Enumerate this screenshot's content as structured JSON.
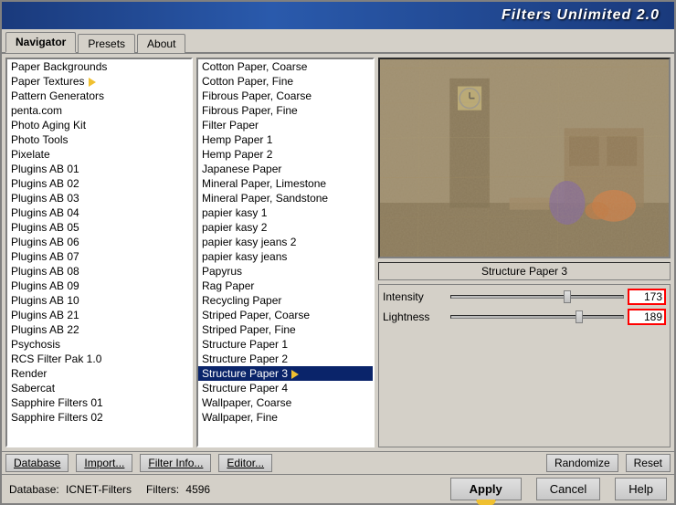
{
  "window": {
    "title": "Filters Unlimited 2.0"
  },
  "tabs": [
    {
      "id": "navigator",
      "label": "Navigator",
      "active": true
    },
    {
      "id": "presets",
      "label": "Presets",
      "active": false
    },
    {
      "id": "about",
      "label": "About",
      "active": false
    }
  ],
  "categories": [
    {
      "id": 1,
      "label": "Paper Backgrounds",
      "selected": false
    },
    {
      "id": 2,
      "label": "Paper Textures",
      "selected": false,
      "hint": true
    },
    {
      "id": 3,
      "label": "Pattern Generators",
      "selected": false
    },
    {
      "id": 4,
      "label": "penta.com",
      "selected": false
    },
    {
      "id": 5,
      "label": "Photo Aging Kit",
      "selected": false
    },
    {
      "id": 6,
      "label": "Photo Tools",
      "selected": false
    },
    {
      "id": 7,
      "label": "Pixelate",
      "selected": false
    },
    {
      "id": 8,
      "label": "Plugins AB 01",
      "selected": false
    },
    {
      "id": 9,
      "label": "Plugins AB 02",
      "selected": false
    },
    {
      "id": 10,
      "label": "Plugins AB 03",
      "selected": false
    },
    {
      "id": 11,
      "label": "Plugins AB 04",
      "selected": false
    },
    {
      "id": 12,
      "label": "Plugins AB 05",
      "selected": false
    },
    {
      "id": 13,
      "label": "Plugins AB 06",
      "selected": false
    },
    {
      "id": 14,
      "label": "Plugins AB 07",
      "selected": false
    },
    {
      "id": 15,
      "label": "Plugins AB 08",
      "selected": false
    },
    {
      "id": 16,
      "label": "Plugins AB 09",
      "selected": false
    },
    {
      "id": 17,
      "label": "Plugins AB 10",
      "selected": false
    },
    {
      "id": 18,
      "label": "Plugins AB 21",
      "selected": false
    },
    {
      "id": 19,
      "label": "Plugins AB 22",
      "selected": false
    },
    {
      "id": 20,
      "label": "Psychosis",
      "selected": false
    },
    {
      "id": 21,
      "label": "RCS Filter Pak 1.0",
      "selected": false
    },
    {
      "id": 22,
      "label": "Render",
      "selected": false
    },
    {
      "id": 23,
      "label": "Sabercat",
      "selected": false
    },
    {
      "id": 24,
      "label": "Sapphire Filters 01",
      "selected": false
    },
    {
      "id": 25,
      "label": "Sapphire Filters 02",
      "selected": false
    }
  ],
  "filters": [
    {
      "id": 1,
      "label": "Cotton Paper, Coarse"
    },
    {
      "id": 2,
      "label": "Cotton Paper, Fine"
    },
    {
      "id": 3,
      "label": "Fibrous Paper, Coarse"
    },
    {
      "id": 4,
      "label": "Fibrous Paper, Fine"
    },
    {
      "id": 5,
      "label": "Filter Paper"
    },
    {
      "id": 6,
      "label": "Hemp Paper 1"
    },
    {
      "id": 7,
      "label": "Hemp Paper 2"
    },
    {
      "id": 8,
      "label": "Japanese Paper"
    },
    {
      "id": 9,
      "label": "Mineral Paper, Limestone"
    },
    {
      "id": 10,
      "label": "Mineral Paper, Sandstone"
    },
    {
      "id": 11,
      "label": "papier kasy 1"
    },
    {
      "id": 12,
      "label": "papier kasy 2"
    },
    {
      "id": 13,
      "label": "papier kasy jeans 2"
    },
    {
      "id": 14,
      "label": "papier kasy jeans"
    },
    {
      "id": 15,
      "label": "Papyrus"
    },
    {
      "id": 16,
      "label": "Rag Paper"
    },
    {
      "id": 17,
      "label": "Recycling Paper"
    },
    {
      "id": 18,
      "label": "Striped Paper, Coarse"
    },
    {
      "id": 19,
      "label": "Striped Paper, Fine"
    },
    {
      "id": 20,
      "label": "Structure Paper 1"
    },
    {
      "id": 21,
      "label": "Structure Paper 2"
    },
    {
      "id": 22,
      "label": "Structure Paper 3",
      "selected": true
    },
    {
      "id": 23,
      "label": "Structure Paper 4"
    },
    {
      "id": 24,
      "label": "Wallpaper, Coarse"
    },
    {
      "id": 25,
      "label": "Wallpaper, Fine"
    }
  ],
  "preview": {
    "filter_name": "Structure Paper 3"
  },
  "params": [
    {
      "id": "intensity",
      "label": "Intensity",
      "value": 173,
      "max": 255,
      "slider_pct": 68
    },
    {
      "id": "lightness",
      "label": "Lightness",
      "value": 189,
      "max": 255,
      "slider_pct": 74
    }
  ],
  "toolbar": {
    "database_label": "Database",
    "import_label": "Import...",
    "filter_info_label": "Filter Info...",
    "editor_label": "Editor...",
    "randomize_label": "Randomize",
    "reset_label": "Reset"
  },
  "statusbar": {
    "database_label": "Database:",
    "database_value": "ICNET-Filters",
    "filters_label": "Filters:",
    "filters_count": "4596"
  },
  "buttons": {
    "apply": "Apply",
    "cancel": "Cancel",
    "help": "Help"
  }
}
